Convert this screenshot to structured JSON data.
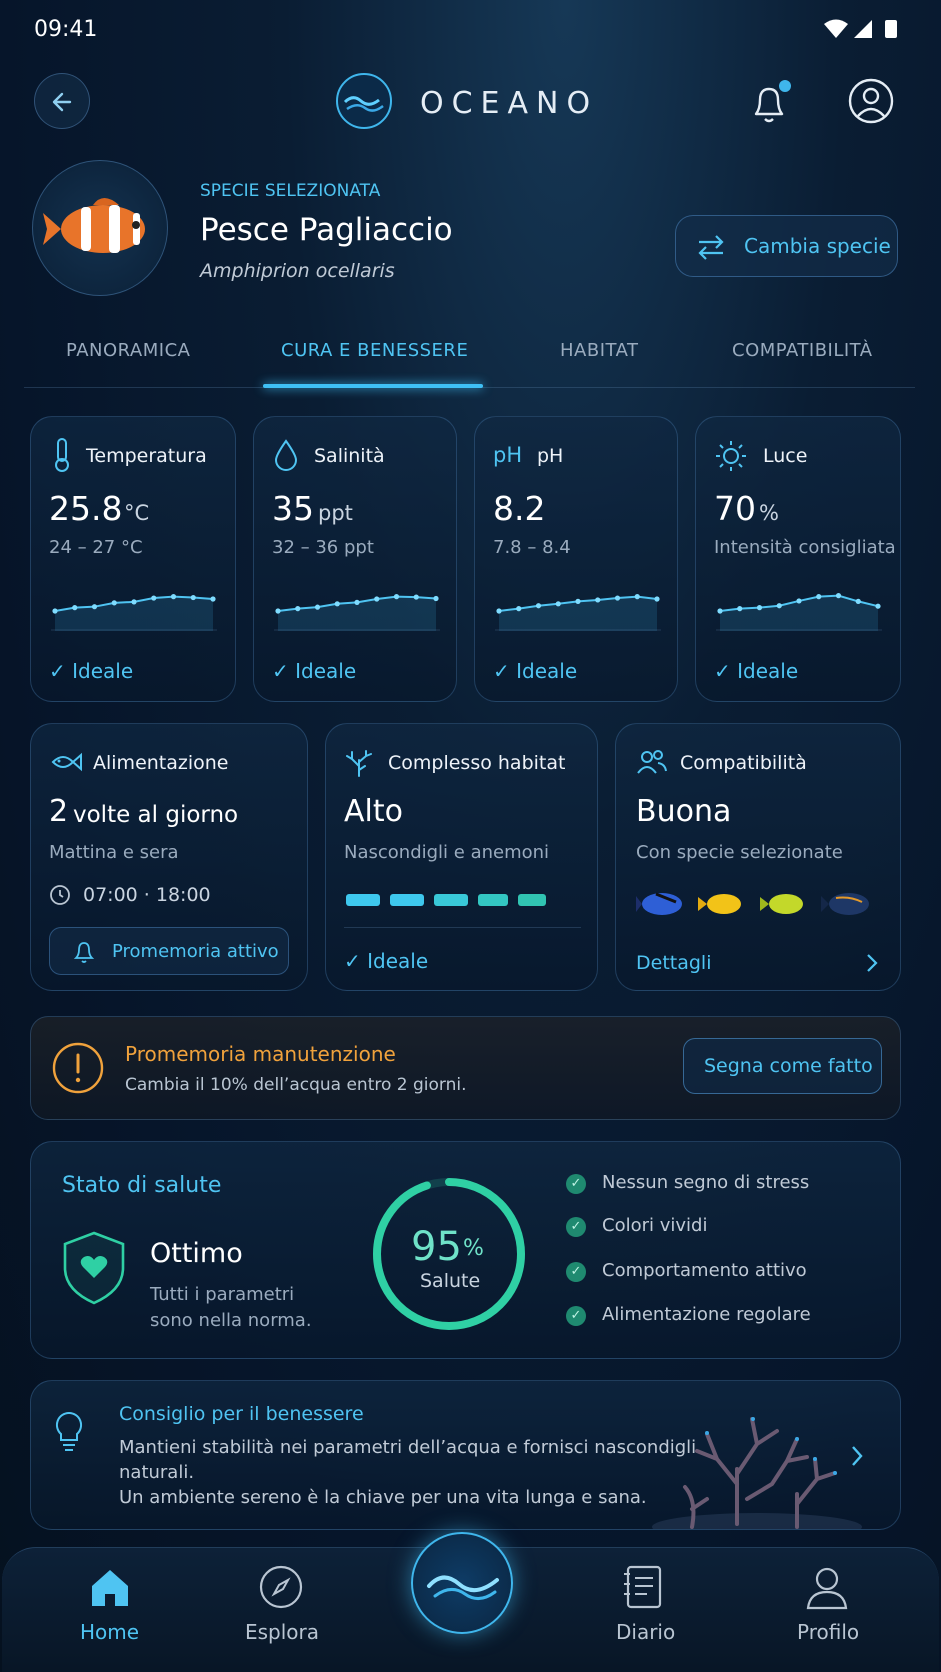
{
  "status_bar": {
    "time": "09:41"
  },
  "header": {
    "brand": "OCEANO"
  },
  "species": {
    "eyebrow": "SPECIE SELEZIONATA",
    "name": "Pesce Pagliaccio",
    "scientific": "Amphiprion ocellaris",
    "change_label": "Cambia specie"
  },
  "tabs": [
    "PANORAMICA",
    "CURA E BENESSERE",
    "HABITAT",
    "COMPATIBILITÀ"
  ],
  "metrics": [
    {
      "label": "Temperatura",
      "value": "25.8",
      "unit": "°C",
      "range": "24 – 27 °C",
      "status": "Ideale",
      "icon": "thermometer-icon",
      "trend": [
        0.25,
        0.32,
        0.34,
        0.42,
        0.44,
        0.52,
        0.55,
        0.53,
        0.5
      ]
    },
    {
      "label": "Salinità",
      "value": "35",
      "unit": "ppt",
      "range": "32 – 36 ppt",
      "status": "Ideale",
      "icon": "droplet-icon",
      "trend": [
        0.25,
        0.3,
        0.33,
        0.4,
        0.43,
        0.5,
        0.55,
        0.54,
        0.51
      ]
    },
    {
      "label": "pH",
      "icon_text": "pH",
      "value": "8.2",
      "unit": "",
      "range": "7.8 – 8.4",
      "status": "Ideale",
      "icon": "ph-icon",
      "trend": [
        0.25,
        0.3,
        0.36,
        0.4,
        0.45,
        0.48,
        0.52,
        0.55,
        0.5
      ]
    },
    {
      "label": "Luce",
      "value": "70",
      "unit": "%",
      "range": "Intensità consigliata",
      "status": "Ideale",
      "icon": "sun-icon",
      "trend": [
        0.25,
        0.3,
        0.32,
        0.36,
        0.46,
        0.55,
        0.57,
        0.45,
        0.35
      ]
    }
  ],
  "feeding": {
    "label": "Alimentazione",
    "value": "2",
    "unit": "volte al giorno",
    "sub": "Mattina e sera",
    "times": "07:00 · 18:00",
    "reminder": "Promemoria attivo"
  },
  "habitat": {
    "label": "Complesso habitat",
    "value": "Alto",
    "sub": "Nascondigli e anemoni",
    "level": 1.0,
    "status": "Ideale"
  },
  "compat": {
    "label": "Compatibilità",
    "value": "Buona",
    "sub": "Con specie selezionate",
    "link": "Dettagli"
  },
  "maintenance": {
    "title": "Promemoria manutenzione",
    "text": "Cambia il 10% dell’acqua entro 2 giorni.",
    "action": "Segna come fatto"
  },
  "health": {
    "title": "Stato di salute",
    "state": "Ottimo",
    "desc1": "Tutti i parametri",
    "desc2": "sono nella norma.",
    "percent": 95,
    "percent_text": "95",
    "percent_sign": "%",
    "caption": "Salute",
    "checks": [
      "Nessun segno di stress",
      "Colori vividi",
      "Comportamento attivo",
      "Alimentazione regolare"
    ],
    "colors": {
      "ring": "#2fd0a4",
      "accent": "#4fc4f2"
    }
  },
  "tip": {
    "title": "Consiglio per il benessere",
    "line1": "Mantieni stabilità nei parametri dell’acqua e fornisci nascondigli",
    "line2": "naturali.",
    "line3": "Un ambiente sereno è la chiave per una vita lunga e sana."
  },
  "nav": {
    "home": "Home",
    "explore": "Esplora",
    "journal": "Diario",
    "profile": "Profilo"
  }
}
